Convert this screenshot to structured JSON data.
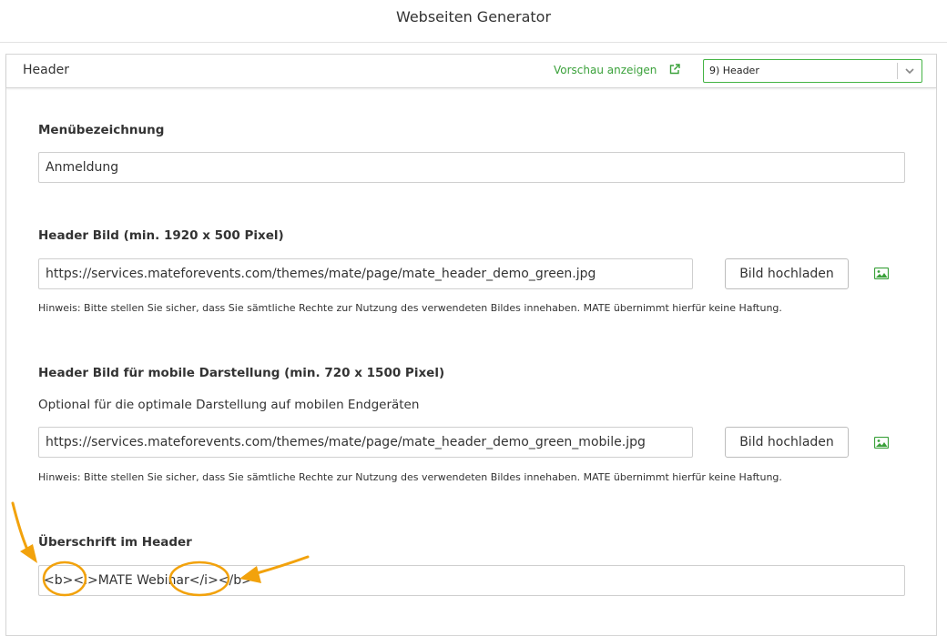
{
  "app": {
    "title": "Webseiten Generator"
  },
  "panel": {
    "title": "Header",
    "preview_label": "Vorschau anzeigen",
    "page_select_value": "9) Header"
  },
  "form": {
    "menu_label": "Menübezeichnung",
    "menu_value": "Anmeldung",
    "header_image_label": "Header Bild (min. 1920 x 500 Pixel)",
    "header_image_value": "https://services.mateforevents.com/themes/mate/page/mate_header_demo_green.jpg",
    "upload_button_label": "Bild hochladen",
    "hint": "Hinweis: Bitte stellen Sie sicher, dass Sie sämtliche Rechte zur Nutzung des verwendeten Bildes innehaben. MATE übernimmt hierfür keine Haftung.",
    "mobile_image_label": "Header Bild für mobile Darstellung (min. 720 x 1500 Pixel)",
    "mobile_image_desc": "Optional für die optimale Darstellung auf mobilen Endgeräten",
    "mobile_image_value": "https://services.mateforevents.com/themes/mate/page/mate_header_demo_green_mobile.jpg",
    "heading_label": "Überschrift im Header",
    "heading_value": "<b><i>MATE Webinar</i></b>"
  },
  "colors": {
    "accent_green": "#3aa13a",
    "annotation_orange": "#f2a20c"
  },
  "icons": {
    "external": "external-link-icon",
    "image": "image-icon",
    "chevron": "chevron-down-icon"
  }
}
